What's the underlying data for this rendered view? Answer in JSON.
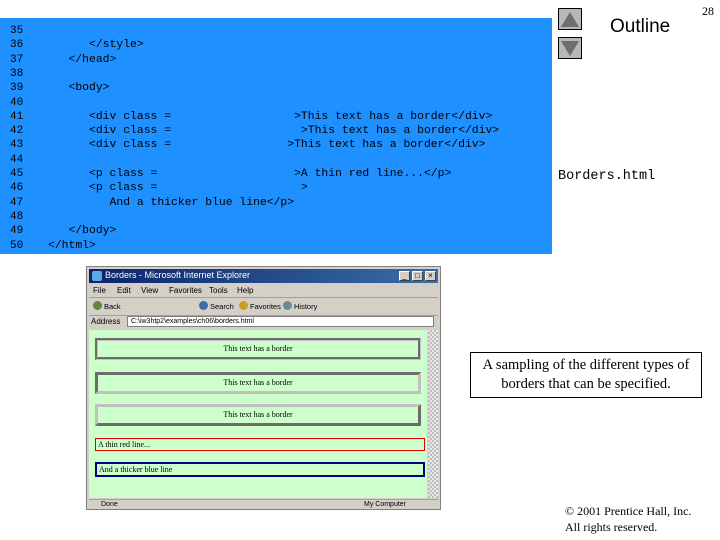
{
  "slide": {
    "page_number": "28",
    "outline_label": "Outline",
    "file_name": "Borders.html",
    "caption": "A sampling of the different types of borders that can be specified.",
    "copyright_line1": "© 2001 Prentice Hall, Inc.",
    "copyright_line2": "All rights reserved."
  },
  "code": {
    "lines": [
      {
        "num": "35",
        "text": ""
      },
      {
        "num": "36",
        "text": "      </style>"
      },
      {
        "num": "37",
        "text": "   </head>"
      },
      {
        "num": "38",
        "text": ""
      },
      {
        "num": "39",
        "text": "   <body>"
      },
      {
        "num": "40",
        "text": ""
      },
      {
        "num": "41",
        "text": "      <div class =                  >This text has a border</div>"
      },
      {
        "num": "42",
        "text": "      <div class =                   >This text has a border</div>"
      },
      {
        "num": "43",
        "text": "      <div class =                 >This text has a border</div>"
      },
      {
        "num": "44",
        "text": ""
      },
      {
        "num": "45",
        "text": "      <p class =                    >A thin red line...</p>"
      },
      {
        "num": "46",
        "text": "      <p class =                     >"
      },
      {
        "num": "47",
        "text": "         And a thicker blue line</p>"
      },
      {
        "num": "48",
        "text": ""
      },
      {
        "num": "49",
        "text": "   </body>"
      },
      {
        "num": "50",
        "text": "</html>"
      }
    ]
  },
  "browser": {
    "title": "Borders - Microsoft Internet Explorer",
    "menu": [
      "File",
      "Edit",
      "View",
      "Favorites",
      "Tools",
      "Help"
    ],
    "toolbar": [
      "Back",
      "Search",
      "Favorites",
      "History"
    ],
    "address_label": "Address",
    "address_value": "C:\\iw3htp2\\examples\\ch06\\borders.html",
    "bordered_text": "This text has a border",
    "thin_line_text": "A thin red line...",
    "thick_line_text": "And a thicker blue line",
    "status_left": "Done",
    "status_right": "My Computer"
  },
  "colors": {
    "code_panel": "#1e90ff",
    "page_background": "#ccffcc",
    "thin_border": "#e00000",
    "thick_border": "#000080"
  }
}
